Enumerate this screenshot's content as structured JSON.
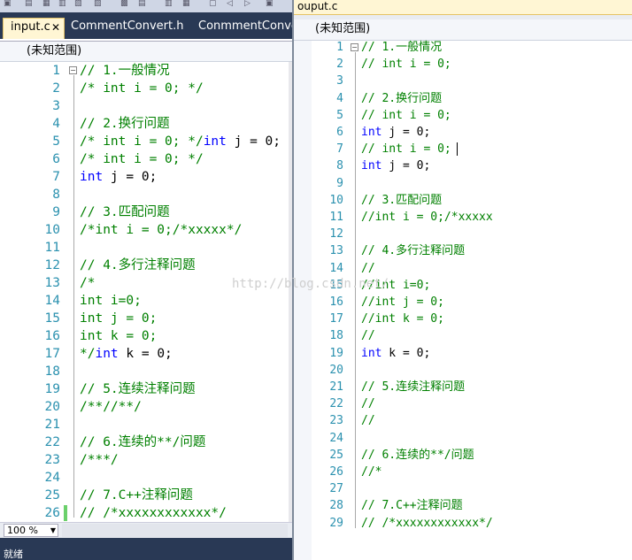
{
  "left_pane": {
    "tabs": [
      {
        "label": "input.c",
        "active": true,
        "close": "✕"
      },
      {
        "label": "CommentConvert.h",
        "active": false
      },
      {
        "label": "ConmmentConver",
        "active": false
      }
    ],
    "scope": "(未知范围)",
    "zoom": "100 %",
    "status": "就绪",
    "lines": [
      {
        "n": "1",
        "parts": [
          [
            "c",
            "// 1.一般情况"
          ]
        ]
      },
      {
        "n": "2",
        "parts": [
          [
            "c",
            "/* int i = 0; */"
          ]
        ]
      },
      {
        "n": "3",
        "parts": []
      },
      {
        "n": "4",
        "parts": [
          [
            "c",
            "// 2.换行问题"
          ]
        ]
      },
      {
        "n": "5",
        "parts": [
          [
            "c",
            "/* int i = 0; */"
          ],
          [
            "k",
            "int"
          ],
          [
            "p",
            " j = 0;"
          ]
        ]
      },
      {
        "n": "6",
        "parts": [
          [
            "c",
            "/* int i = 0; */"
          ]
        ]
      },
      {
        "n": "7",
        "parts": [
          [
            "k",
            "int"
          ],
          [
            "p",
            " j = 0;"
          ]
        ]
      },
      {
        "n": "8",
        "parts": []
      },
      {
        "n": "9",
        "parts": [
          [
            "c",
            "// 3.匹配问题"
          ]
        ]
      },
      {
        "n": "10",
        "parts": [
          [
            "c",
            "/*int i = 0;/*xxxxx*/"
          ]
        ]
      },
      {
        "n": "11",
        "parts": []
      },
      {
        "n": "12",
        "parts": [
          [
            "c",
            "// 4.多行注释问题"
          ]
        ]
      },
      {
        "n": "13",
        "parts": [
          [
            "c",
            "/*"
          ]
        ]
      },
      {
        "n": "14",
        "parts": [
          [
            "c",
            "int i=0;"
          ]
        ]
      },
      {
        "n": "15",
        "parts": [
          [
            "c",
            "int j = 0;"
          ]
        ]
      },
      {
        "n": "16",
        "parts": [
          [
            "c",
            "int k = 0;"
          ]
        ]
      },
      {
        "n": "17",
        "parts": [
          [
            "c",
            "*/"
          ],
          [
            "k",
            "int"
          ],
          [
            "p",
            " k = 0;"
          ]
        ]
      },
      {
        "n": "18",
        "parts": []
      },
      {
        "n": "19",
        "parts": [
          [
            "c",
            "// 5.连续注释问题"
          ]
        ]
      },
      {
        "n": "20",
        "parts": [
          [
            "c",
            "/**//**/"
          ]
        ]
      },
      {
        "n": "21",
        "parts": []
      },
      {
        "n": "22",
        "parts": [
          [
            "c",
            "// 6.连续的**/问题"
          ]
        ]
      },
      {
        "n": "23",
        "parts": [
          [
            "c",
            "/***/"
          ]
        ]
      },
      {
        "n": "24",
        "parts": []
      },
      {
        "n": "25",
        "parts": [
          [
            "c",
            "// 7.C++注释问题"
          ]
        ]
      },
      {
        "n": "26",
        "parts": [
          [
            "c",
            "// /*xxxxxxxxxxxx*/"
          ]
        ]
      }
    ]
  },
  "right_pane": {
    "title": "ouput.c",
    "scope": "(未知范围)",
    "lines": [
      {
        "n": "1",
        "parts": [
          [
            "c",
            "// 1.一般情况"
          ]
        ]
      },
      {
        "n": "2",
        "parts": [
          [
            "c",
            "// int i = 0;"
          ]
        ]
      },
      {
        "n": "3",
        "parts": []
      },
      {
        "n": "4",
        "parts": [
          [
            "c",
            "// 2.换行问题"
          ]
        ]
      },
      {
        "n": "5",
        "parts": [
          [
            "c",
            "// int i = 0;"
          ]
        ]
      },
      {
        "n": "6",
        "parts": [
          [
            "k",
            "int"
          ],
          [
            "p",
            " j = 0;"
          ]
        ]
      },
      {
        "n": "7",
        "parts": [
          [
            "c",
            "// int i = 0;"
          ]
        ]
      },
      {
        "n": "8",
        "parts": [
          [
            "k",
            "int"
          ],
          [
            "p",
            " j = 0;"
          ]
        ]
      },
      {
        "n": "9",
        "parts": []
      },
      {
        "n": "10",
        "parts": [
          [
            "c",
            "// 3.匹配问题"
          ]
        ]
      },
      {
        "n": "11",
        "parts": [
          [
            "c",
            "//int i = 0;/*xxxxx"
          ]
        ]
      },
      {
        "n": "12",
        "parts": []
      },
      {
        "n": "13",
        "parts": [
          [
            "c",
            "// 4.多行注释问题"
          ]
        ]
      },
      {
        "n": "14",
        "parts": [
          [
            "c",
            "//"
          ]
        ]
      },
      {
        "n": "15",
        "parts": [
          [
            "c",
            "//int i=0;"
          ]
        ]
      },
      {
        "n": "16",
        "parts": [
          [
            "c",
            "//int j = 0;"
          ]
        ]
      },
      {
        "n": "17",
        "parts": [
          [
            "c",
            "//int k = 0;"
          ]
        ]
      },
      {
        "n": "18",
        "parts": [
          [
            "c",
            "//"
          ]
        ]
      },
      {
        "n": "19",
        "parts": [
          [
            "k",
            "int"
          ],
          [
            "p",
            " k = 0;"
          ]
        ]
      },
      {
        "n": "20",
        "parts": []
      },
      {
        "n": "21",
        "parts": [
          [
            "c",
            "// 5.连续注释问题"
          ]
        ]
      },
      {
        "n": "22",
        "parts": [
          [
            "c",
            "//"
          ]
        ]
      },
      {
        "n": "23",
        "parts": [
          [
            "c",
            "//"
          ]
        ]
      },
      {
        "n": "24",
        "parts": []
      },
      {
        "n": "25",
        "parts": [
          [
            "c",
            "// 6.连续的**/问题"
          ]
        ]
      },
      {
        "n": "26",
        "parts": [
          [
            "c",
            "//*"
          ]
        ]
      },
      {
        "n": "27",
        "parts": []
      },
      {
        "n": "28",
        "parts": [
          [
            "c",
            "// 7.C++注释问题"
          ]
        ]
      },
      {
        "n": "29",
        "parts": [
          [
            "c",
            "// /*xxxxxxxxxxxx*/"
          ]
        ]
      }
    ]
  },
  "watermark": "http://blog.csdn.net/",
  "colors": {
    "comment": "#008000",
    "keyword": "#0000ff",
    "line_number": "#2b91af",
    "tab_bg": "#293955"
  },
  "icons": [
    "fold-collapse-icon",
    "dropdown-arrow-icon",
    "tab-close-icon"
  ]
}
